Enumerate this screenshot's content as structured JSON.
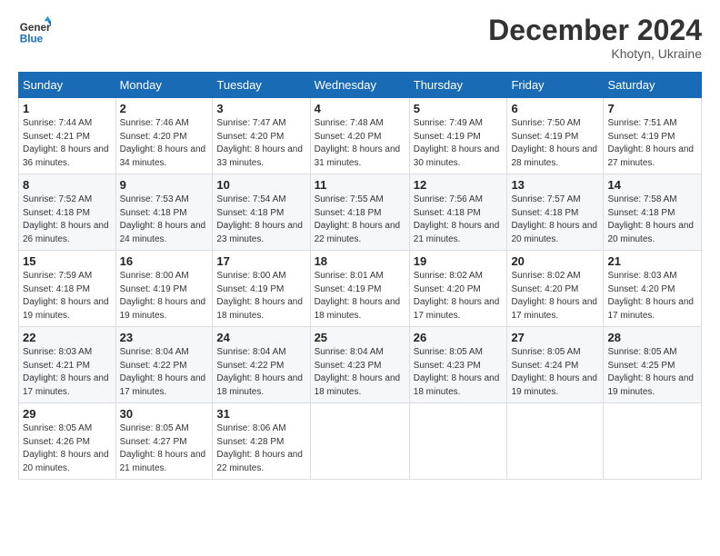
{
  "header": {
    "logo_line1": "General",
    "logo_line2": "Blue",
    "month_title": "December 2024",
    "subtitle": "Khotyn, Ukraine"
  },
  "days_of_week": [
    "Sunday",
    "Monday",
    "Tuesday",
    "Wednesday",
    "Thursday",
    "Friday",
    "Saturday"
  ],
  "weeks": [
    [
      {
        "day": 1,
        "sunrise": "7:44 AM",
        "sunset": "4:21 PM",
        "daylight": "8 hours and 36 minutes."
      },
      {
        "day": 2,
        "sunrise": "7:46 AM",
        "sunset": "4:20 PM",
        "daylight": "8 hours and 34 minutes."
      },
      {
        "day": 3,
        "sunrise": "7:47 AM",
        "sunset": "4:20 PM",
        "daylight": "8 hours and 33 minutes."
      },
      {
        "day": 4,
        "sunrise": "7:48 AM",
        "sunset": "4:20 PM",
        "daylight": "8 hours and 31 minutes."
      },
      {
        "day": 5,
        "sunrise": "7:49 AM",
        "sunset": "4:19 PM",
        "daylight": "8 hours and 30 minutes."
      },
      {
        "day": 6,
        "sunrise": "7:50 AM",
        "sunset": "4:19 PM",
        "daylight": "8 hours and 28 minutes."
      },
      {
        "day": 7,
        "sunrise": "7:51 AM",
        "sunset": "4:19 PM",
        "daylight": "8 hours and 27 minutes."
      }
    ],
    [
      {
        "day": 8,
        "sunrise": "7:52 AM",
        "sunset": "4:18 PM",
        "daylight": "8 hours and 26 minutes."
      },
      {
        "day": 9,
        "sunrise": "7:53 AM",
        "sunset": "4:18 PM",
        "daylight": "8 hours and 24 minutes."
      },
      {
        "day": 10,
        "sunrise": "7:54 AM",
        "sunset": "4:18 PM",
        "daylight": "8 hours and 23 minutes."
      },
      {
        "day": 11,
        "sunrise": "7:55 AM",
        "sunset": "4:18 PM",
        "daylight": "8 hours and 22 minutes."
      },
      {
        "day": 12,
        "sunrise": "7:56 AM",
        "sunset": "4:18 PM",
        "daylight": "8 hours and 21 minutes."
      },
      {
        "day": 13,
        "sunrise": "7:57 AM",
        "sunset": "4:18 PM",
        "daylight": "8 hours and 20 minutes."
      },
      {
        "day": 14,
        "sunrise": "7:58 AM",
        "sunset": "4:18 PM",
        "daylight": "8 hours and 20 minutes."
      }
    ],
    [
      {
        "day": 15,
        "sunrise": "7:59 AM",
        "sunset": "4:18 PM",
        "daylight": "8 hours and 19 minutes."
      },
      {
        "day": 16,
        "sunrise": "8:00 AM",
        "sunset": "4:19 PM",
        "daylight": "8 hours and 19 minutes."
      },
      {
        "day": 17,
        "sunrise": "8:00 AM",
        "sunset": "4:19 PM",
        "daylight": "8 hours and 18 minutes."
      },
      {
        "day": 18,
        "sunrise": "8:01 AM",
        "sunset": "4:19 PM",
        "daylight": "8 hours and 18 minutes."
      },
      {
        "day": 19,
        "sunrise": "8:02 AM",
        "sunset": "4:20 PM",
        "daylight": "8 hours and 17 minutes."
      },
      {
        "day": 20,
        "sunrise": "8:02 AM",
        "sunset": "4:20 PM",
        "daylight": "8 hours and 17 minutes."
      },
      {
        "day": 21,
        "sunrise": "8:03 AM",
        "sunset": "4:20 PM",
        "daylight": "8 hours and 17 minutes."
      }
    ],
    [
      {
        "day": 22,
        "sunrise": "8:03 AM",
        "sunset": "4:21 PM",
        "daylight": "8 hours and 17 minutes."
      },
      {
        "day": 23,
        "sunrise": "8:04 AM",
        "sunset": "4:22 PM",
        "daylight": "8 hours and 17 minutes."
      },
      {
        "day": 24,
        "sunrise": "8:04 AM",
        "sunset": "4:22 PM",
        "daylight": "8 hours and 18 minutes."
      },
      {
        "day": 25,
        "sunrise": "8:04 AM",
        "sunset": "4:23 PM",
        "daylight": "8 hours and 18 minutes."
      },
      {
        "day": 26,
        "sunrise": "8:05 AM",
        "sunset": "4:23 PM",
        "daylight": "8 hours and 18 minutes."
      },
      {
        "day": 27,
        "sunrise": "8:05 AM",
        "sunset": "4:24 PM",
        "daylight": "8 hours and 19 minutes."
      },
      {
        "day": 28,
        "sunrise": "8:05 AM",
        "sunset": "4:25 PM",
        "daylight": "8 hours and 19 minutes."
      }
    ],
    [
      {
        "day": 29,
        "sunrise": "8:05 AM",
        "sunset": "4:26 PM",
        "daylight": "8 hours and 20 minutes."
      },
      {
        "day": 30,
        "sunrise": "8:05 AM",
        "sunset": "4:27 PM",
        "daylight": "8 hours and 21 minutes."
      },
      {
        "day": 31,
        "sunrise": "8:06 AM",
        "sunset": "4:28 PM",
        "daylight": "8 hours and 22 minutes."
      },
      null,
      null,
      null,
      null
    ]
  ]
}
